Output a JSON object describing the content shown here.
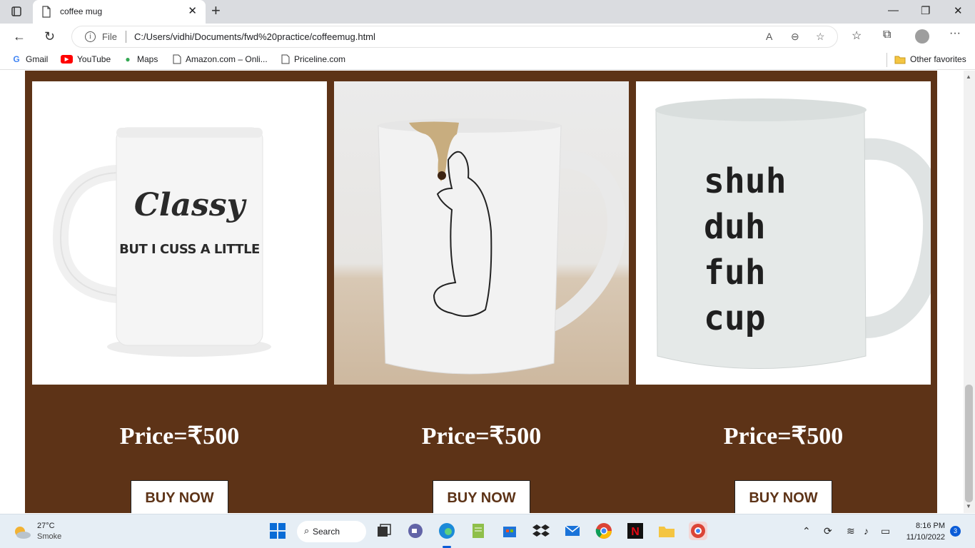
{
  "browser": {
    "tab_title": "coffee mug",
    "url_scheme_label": "File",
    "url": "C:/Users/vidhi/Documents/fwd%20practice/coffeemug.html",
    "bookmarks": [
      "Gmail",
      "YouTube",
      "Maps",
      "Amazon.com – Onli...",
      "Priceline.com"
    ],
    "other_favorites": "Other favorites",
    "read_aloud_label": "A"
  },
  "products": [
    {
      "mug_text_script": "Classy",
      "mug_text_caption": "BUT I CUSS A LITTLE",
      "price": "Price=₹500",
      "buy_label": "BUY NOW"
    },
    {
      "price": "Price=₹500",
      "buy_label": "BUY NOW"
    },
    {
      "mug_lines": [
        "shuh",
        "duh",
        "fuh",
        "cup"
      ],
      "price": "Price=₹500",
      "buy_label": "BUY NOW"
    }
  ],
  "taskbar": {
    "temperature": "27°C",
    "weather": "Smoke",
    "search_label": "Search",
    "time": "8:16 PM",
    "date": "11/10/2022",
    "notification_count": "3"
  },
  "colors": {
    "page_background": "#5d3317",
    "buy_text": "#5d3317"
  }
}
